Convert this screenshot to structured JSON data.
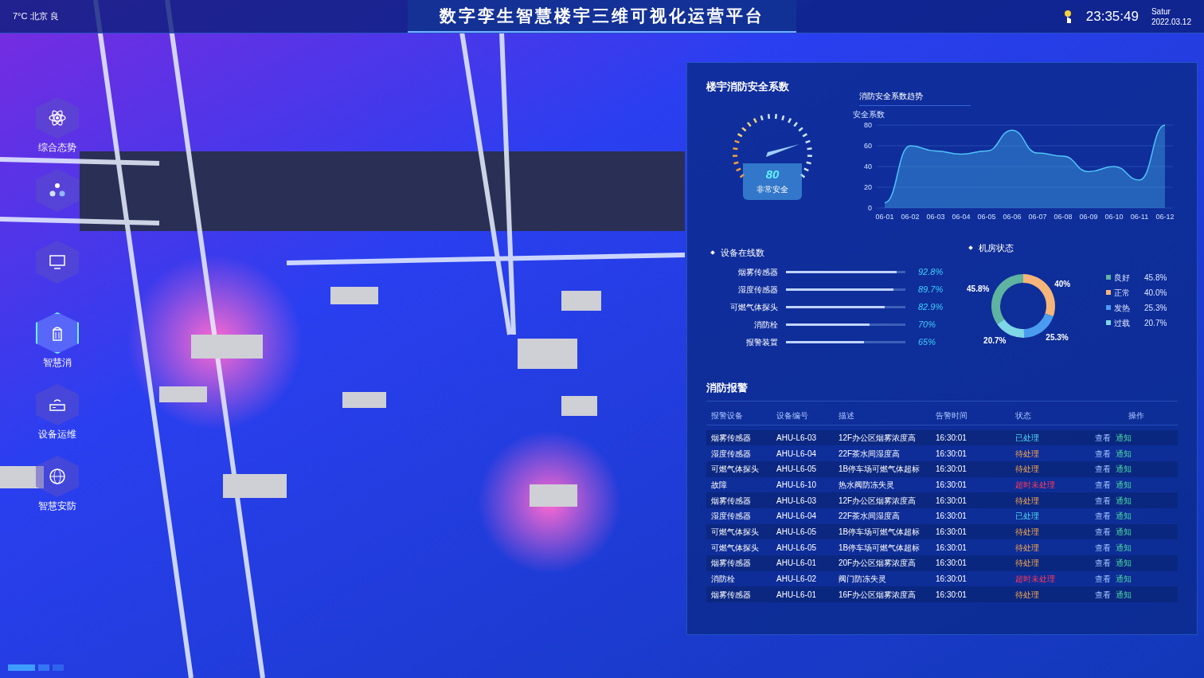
{
  "header": {
    "weather": "7°C 北京  良",
    "title": "数字孪生智慧楼宇三维可视化运营平台",
    "time": "23:35:49",
    "weekday": "Satur",
    "date": "2022.03.12"
  },
  "nav": [
    {
      "label": "综合态势",
      "selected": false
    },
    {
      "selected": false
    },
    {
      "selected": false
    },
    {
      "label": "智慧消",
      "selected": true
    },
    {
      "label": "设备运维",
      "selected": false
    },
    {
      "label": "智慧安防",
      "selected": false
    }
  ],
  "safety": {
    "title": "楼宇消防安全系数",
    "gauge": {
      "value": "80",
      "caption": "非常安全"
    },
    "trend": {
      "title": "消防安全系数趋势",
      "chart_data": {
        "type": "area",
        "ylabel": "安全系数",
        "categories": [
          "06-01",
          "06-02",
          "06-03",
          "06-04",
          "06-05",
          "06-06",
          "06-07",
          "06-08",
          "06-09",
          "06-10",
          "06-11",
          "06-12"
        ],
        "series": [
          {
            "color": "#4fc3f7",
            "values": [
              5,
              60,
              55,
              52,
              55,
              75,
              53,
              50,
              35,
              40,
              27,
              80
            ]
          }
        ],
        "ylim": [
          0,
          80
        ],
        "yticks": [
          0,
          20,
          40,
          60,
          80
        ],
        "grid": true
      }
    }
  },
  "online": {
    "title": "设备在线数",
    "items": [
      {
        "name": "烟雾传感器",
        "level": 0.928,
        "reading": "92.8%"
      },
      {
        "name": "湿度传感器",
        "level": 0.897,
        "reading": "89.7%"
      },
      {
        "name": "可燃气体探头",
        "level": 0.829,
        "reading": "82.9%"
      },
      {
        "name": "消防栓",
        "level": 0.7,
        "reading": "70%"
      },
      {
        "name": "报警装置",
        "level": 0.65,
        "reading": "65%"
      }
    ]
  },
  "room": {
    "title": "机房状态",
    "chart_data": {
      "type": "donut",
      "categories": [
        "良好",
        "正常",
        "发热",
        "过载"
      ],
      "values": [
        45.8,
        40,
        25.3,
        20.7
      ],
      "value_labels": [
        "45.8%",
        "40%",
        "25.3%",
        "20.7%"
      ]
    },
    "slices": [
      {
        "color": "#5fb3a1",
        "legend_value": "45.8%"
      },
      {
        "color": "#f5b57a",
        "legend_value": "40.0%"
      },
      {
        "color": "#4a9cf0",
        "legend_value": "25.3%"
      },
      {
        "color": "#7fd6e6",
        "legend_value": "20.7%"
      }
    ]
  },
  "alarms": {
    "title": "消防报警",
    "columns": [
      "报警设备",
      "设备编号",
      "描述",
      "告警时间",
      "状态",
      "操作"
    ],
    "rows": [
      {
        "device": "烟雾传感器",
        "code": "AHU-L6-03",
        "desc": "12F办公区烟雾浓度高",
        "time": "16:30:01",
        "status": "已处理",
        "kind": "done",
        "actions": [
          "查看",
          "通知"
        ]
      },
      {
        "device": "湿度传感器",
        "code": "AHU-L6-04",
        "desc": "22F茶水间湿度高",
        "time": "16:30:01",
        "status": "待处理",
        "kind": "pending",
        "actions": [
          "查看",
          "通知"
        ]
      },
      {
        "device": "可燃气体探头",
        "code": "AHU-L6-05",
        "desc": "1B停车场可燃气体超标",
        "time": "16:30:01",
        "status": "待处理",
        "kind": "pending",
        "actions": [
          "查看",
          "通知"
        ]
      },
      {
        "device": "故障",
        "code": "AHU-L6-10",
        "desc": "热水阀防冻失灵",
        "time": "16:30:01",
        "status": "超时未处理",
        "kind": "overdue",
        "actions": [
          "查看",
          "通知"
        ]
      },
      {
        "device": "烟雾传感器",
        "code": "AHU-L6-03",
        "desc": "12F办公区烟雾浓度高",
        "time": "16:30:01",
        "status": "待处理",
        "kind": "pending",
        "actions": [
          "查看",
          "通知"
        ]
      },
      {
        "device": "湿度传感器",
        "code": "AHU-L6-04",
        "desc": "22F茶水间湿度高",
        "time": "16:30:01",
        "status": "已处理",
        "kind": "done",
        "actions": [
          "查看",
          "通知"
        ]
      },
      {
        "device": "可燃气体探头",
        "code": "AHU-L6-05",
        "desc": "1B停车场可燃气体超标",
        "time": "16:30:01",
        "status": "待处理",
        "kind": "pending",
        "actions": [
          "查看",
          "通知"
        ]
      },
      {
        "device": "可燃气体探头",
        "code": "AHU-L6-05",
        "desc": "1B停车场可燃气体超标",
        "time": "16:30:01",
        "status": "待处理",
        "kind": "pending",
        "actions": [
          "查看",
          "通知"
        ]
      },
      {
        "device": "烟雾传感器",
        "code": "AHU-L6-01",
        "desc": "20F办公区烟雾浓度高",
        "time": "16:30:01",
        "status": "待处理",
        "kind": "pending",
        "actions": [
          "查看",
          "通知"
        ]
      },
      {
        "device": "消防栓",
        "code": "AHU-L6-02",
        "desc": "阀门防冻失灵",
        "time": "16:30:01",
        "status": "超时未处理",
        "kind": "overdue",
        "actions": [
          "查看",
          "通知"
        ]
      },
      {
        "device": "烟雾传感器",
        "code": "AHU-L6-01",
        "desc": "16F办公区烟雾浓度高",
        "time": "16:30:01",
        "status": "待处理",
        "kind": "pending",
        "actions": [
          "查看",
          "通知"
        ]
      }
    ]
  }
}
